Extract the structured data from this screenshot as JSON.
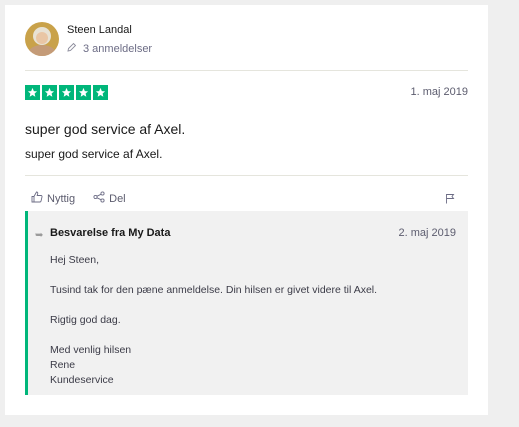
{
  "author": {
    "name": "Steen Landal",
    "reviews_count": "3 anmeldelser"
  },
  "review": {
    "rating": 5,
    "rating_color": "#00b67a",
    "date": "1. maj 2019",
    "title": "super god service af Axel.",
    "body": "super god service af Axel."
  },
  "actions": {
    "useful_label": "Nyttig",
    "share_label": "Del"
  },
  "reply": {
    "title": "Besvarelse fra My Data",
    "date": "2. maj 2019",
    "lines": [
      "Hej Steen,",
      "Tusind tak for den pæne anmeldelse. Din hilsen er givet videre til Axel.",
      "Rigtig god dag.",
      "Med venlig hilsen",
      "Rene",
      "Kundeservice"
    ]
  }
}
